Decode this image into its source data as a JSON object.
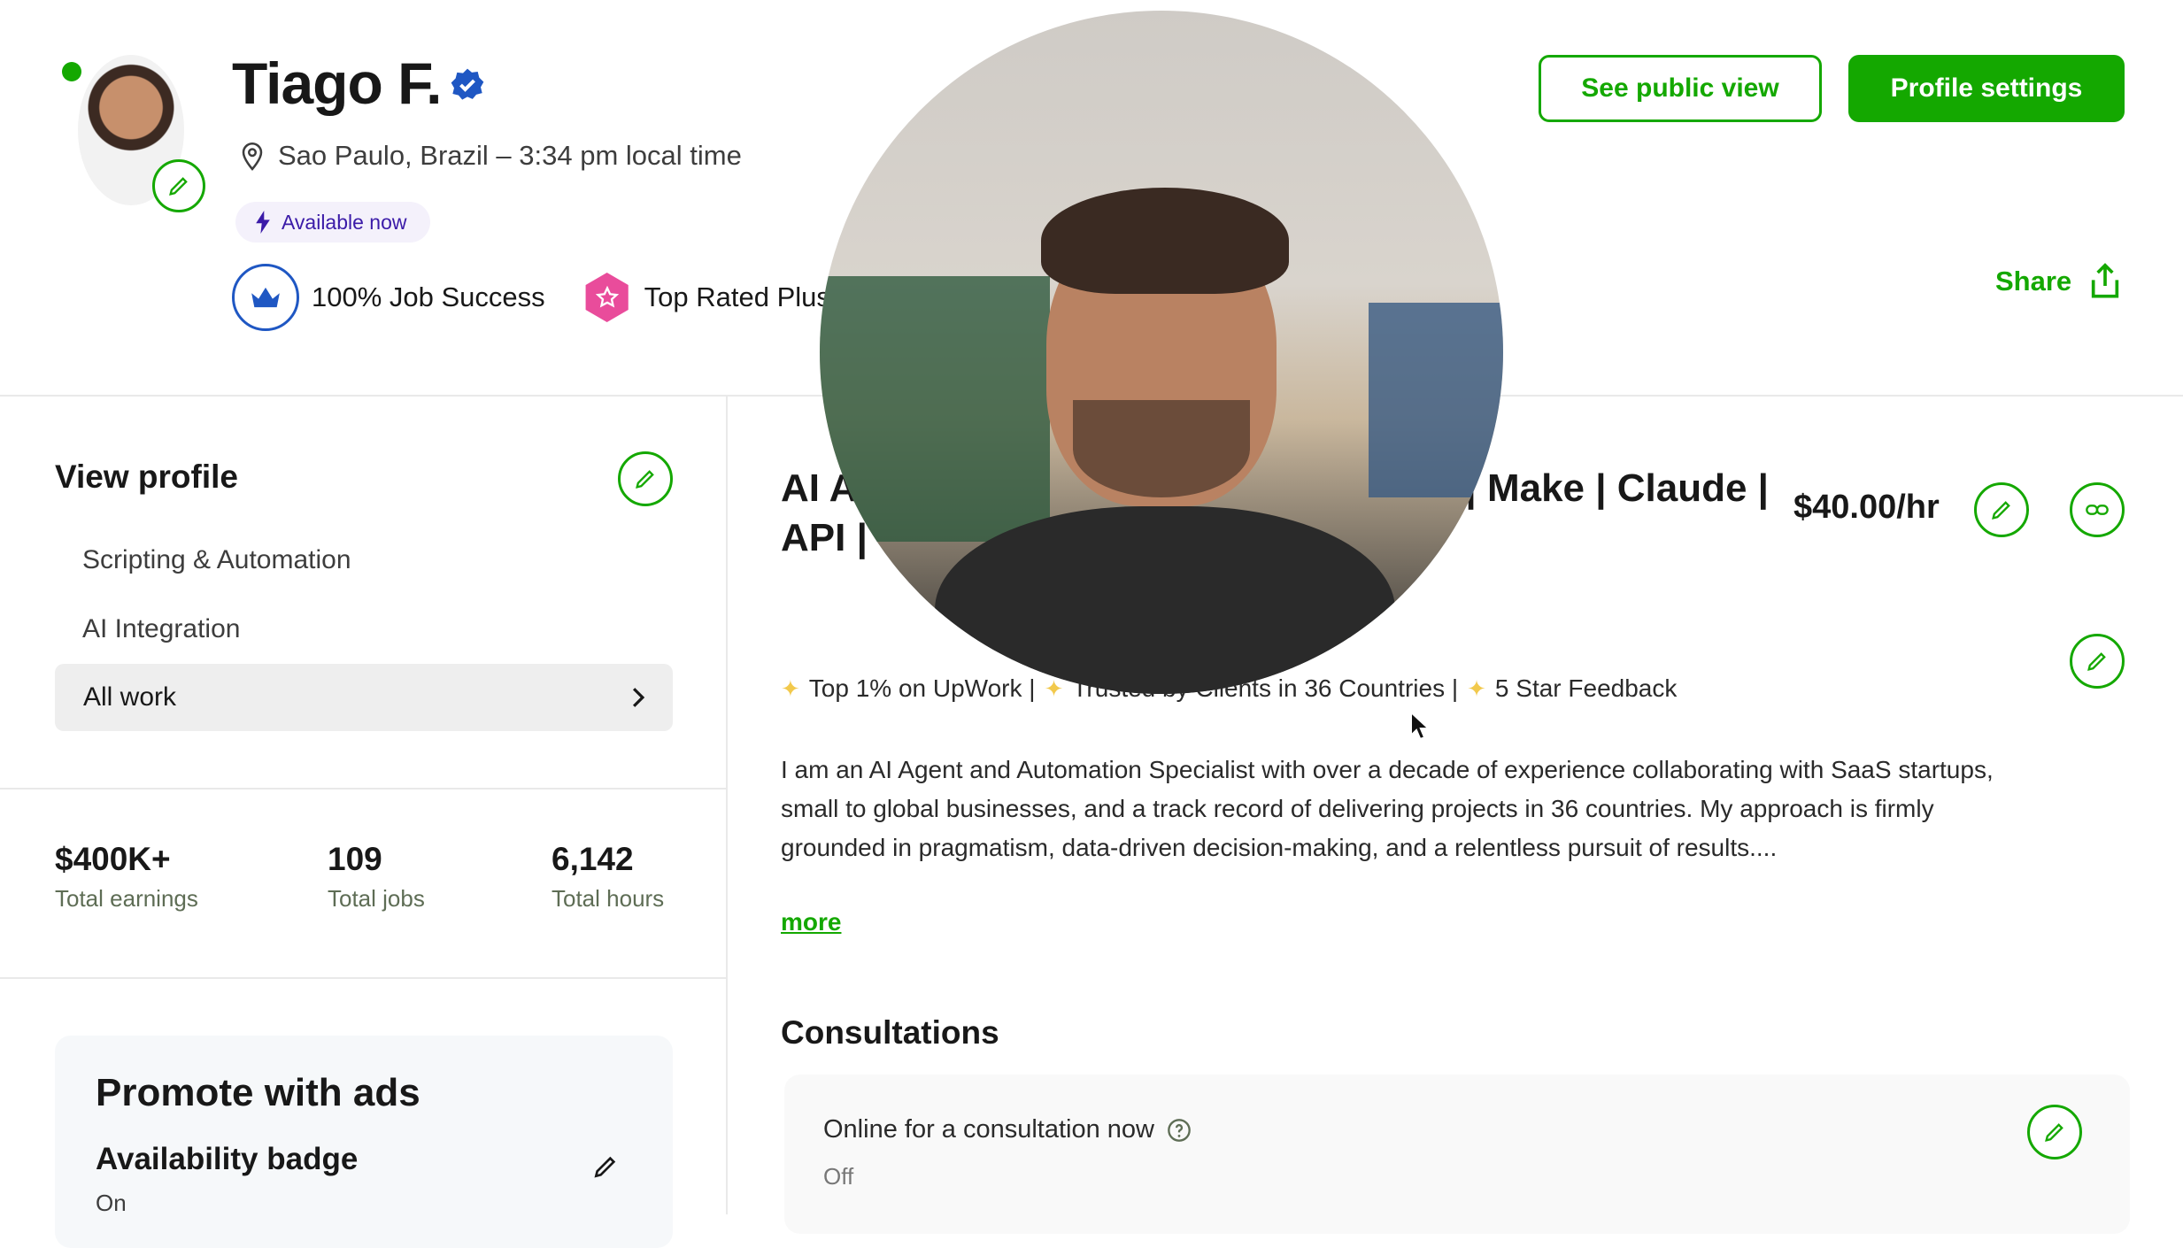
{
  "profile": {
    "name": "Tiago F.",
    "location": "Sao Paulo, Brazil – 3:34 pm local time",
    "availability_pill": "Available now",
    "job_success": "100% Job Success",
    "top_rated": "Top Rated Plus"
  },
  "header_actions": {
    "public_view_label": "See public view",
    "settings_label": "Profile settings",
    "share_label": "Share"
  },
  "sidebar": {
    "view_profile_label": "View profile",
    "items": [
      {
        "label": "Scripting & Automation"
      },
      {
        "label": "AI Integration"
      },
      {
        "label": "All work",
        "selected": true
      }
    ],
    "stats": [
      {
        "value": "$400K+",
        "label": "Total earnings"
      },
      {
        "value": "109",
        "label": "Total jobs"
      },
      {
        "value": "6,142",
        "label": "Total hours"
      }
    ],
    "promote": {
      "title": "Promote with ads",
      "availability_badge": "Availability badge",
      "availability_value": "On"
    }
  },
  "main": {
    "title_line1_left": "AI A",
    "title_line1_right": "| Make | Claude |",
    "title_line2_left": "API |",
    "rate": "$40.00/hr",
    "highlights": [
      "Top 1% on UpWork |",
      "Trusted by Clients in 36 Countries |",
      "5 Star Feedback"
    ],
    "bio": "I am an AI Agent and Automation Specialist with over a decade of experience collaborating with SaaS startups, small to global businesses, and a track record of delivering projects in 36 countries. My approach is firmly grounded in pragmatism, data-driven decision-making, and a relentless pursuit of results....",
    "more_label": "more",
    "consultations": {
      "heading": "Consultations",
      "online_label": "Online for a consultation now",
      "online_value": "Off"
    }
  },
  "colors": {
    "brand_green": "#14a800",
    "verified_blue": "#1f57c3",
    "top_rated_pink": "#e94c9b",
    "available_purple": "#3b1ba8"
  }
}
